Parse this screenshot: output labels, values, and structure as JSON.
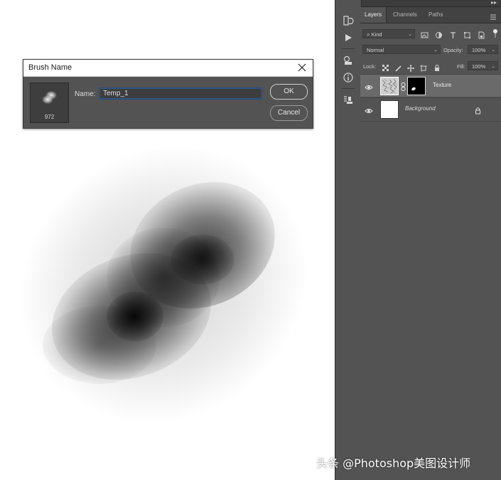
{
  "dialog": {
    "title": "Brush Name",
    "preview_size": "972",
    "name_label": "Name:",
    "name_value": "Temp_1",
    "ok_label": "OK",
    "cancel_label": "Cancel"
  },
  "layers_panel": {
    "tabs": [
      {
        "label": "Layers",
        "active": true
      },
      {
        "label": "Channels",
        "active": false
      },
      {
        "label": "Paths",
        "active": false
      }
    ],
    "filter_kind": "Kind",
    "blend_mode": "Normal",
    "opacity_label": "Opacity:",
    "opacity_value": "100%",
    "lock_label": "Lock:",
    "fill_label": "Fill:",
    "fill_value": "100%",
    "layers": [
      {
        "name": "Texture",
        "visible": true,
        "selected": true,
        "has_mask": true
      },
      {
        "name": "Background",
        "visible": true,
        "selected": false,
        "locked": true
      }
    ]
  },
  "watermark": "头条 @Photoshop美图设计师",
  "colors": {
    "panel_bg": "#535353",
    "tab_bar_bg": "#424242",
    "selected_layer": "#6a6a6a",
    "accent_focus": "#2a5a8e"
  }
}
